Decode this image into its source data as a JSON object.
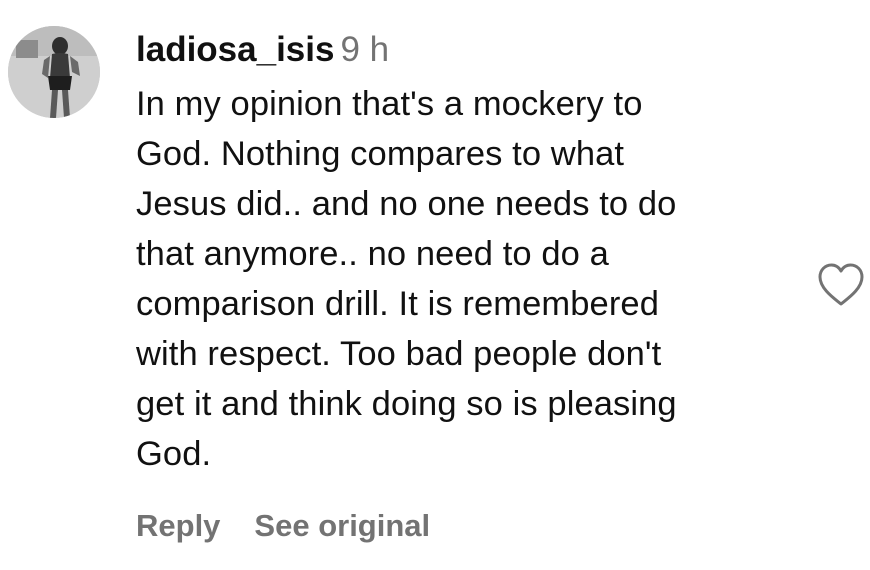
{
  "comment": {
    "username": "ladiosa_isis",
    "time": "9 h",
    "text_lines": [
      "In my opinion that's a mockery to",
      "God. Nothing compares to what",
      "Jesus did.. and no one needs to do",
      "that anymore.. no need to do a",
      "comparison drill. It is remembered",
      "with respect. Too bad people don't",
      "get it and think doing so is pleasing",
      "God."
    ],
    "actions": {
      "reply_label": "Reply",
      "see_original_label": "See original"
    },
    "icons": {
      "avatar": "profile-photo",
      "like": "heart-outline-icon"
    },
    "colors": {
      "text": "#111111",
      "secondary": "#737373"
    }
  }
}
